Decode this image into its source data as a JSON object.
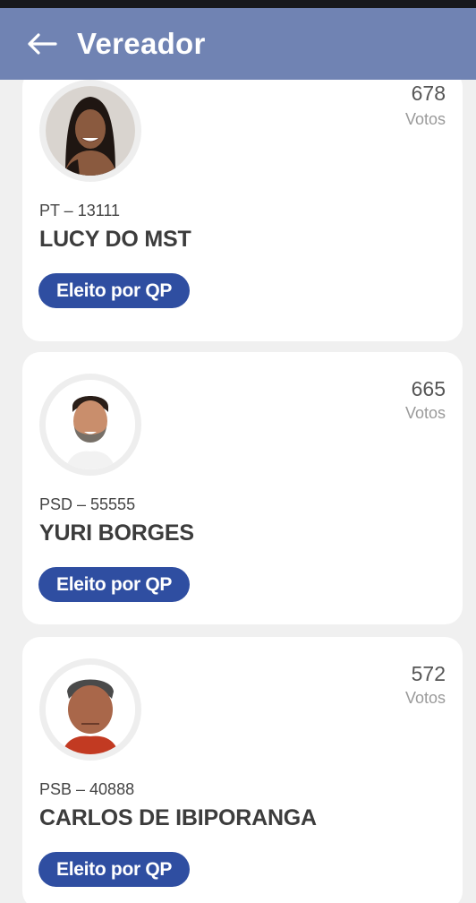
{
  "header": {
    "title": "Vereador",
    "back_icon": "arrow-left-icon",
    "background": "#7083b3"
  },
  "candidates": [
    {
      "votes": "678",
      "votes_label": "Votos",
      "party_number": "PT – 13111",
      "name": "LUCY DO MST",
      "status": "Eleito por QP"
    },
    {
      "votes": "665",
      "votes_label": "Votos",
      "party_number": "PSD – 55555",
      "name": "YURI BORGES",
      "status": "Eleito por QP"
    },
    {
      "votes": "572",
      "votes_label": "Votos",
      "party_number": "PSB – 40888",
      "name": "CARLOS DE IBIPORANGA",
      "status": "Eleito por QP"
    }
  ],
  "colors": {
    "badge": "#2f4ea1",
    "page_background": "#f0f0f0"
  }
}
